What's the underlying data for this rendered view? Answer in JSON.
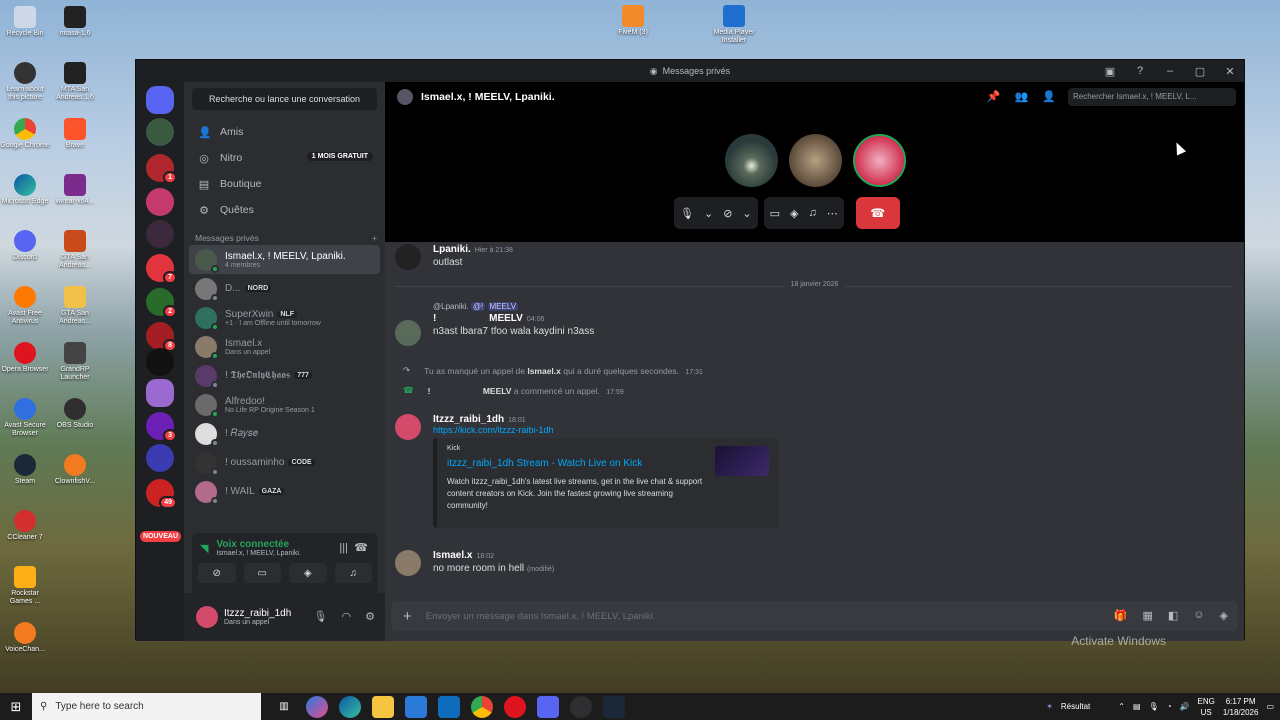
{
  "desktop": {
    "left_icons": [
      "Recycle Bin",
      "mtasa-1.6",
      "Learn about this picture",
      "MTA San Andreas 1.6",
      "Google Chrome",
      "Brave",
      "Microsoft Edge",
      "winrar-x64...",
      "Discord",
      "GTA San Andreas...",
      "Avast Free Antivirus",
      "GTA San Andreas...",
      "Opera Browser",
      "GrandRP Launcher",
      "Avast Secure Browser",
      "OBS Studio",
      "Steam",
      "ClownfishV...",
      "CCleaner 7",
      "Rockstar Games ...",
      "VoiceChan..."
    ],
    "top_icons": [
      "FiveM (3)",
      "Media Player Installer"
    ],
    "watermark": "Activate Windows"
  },
  "window": {
    "title": "Messages privés"
  },
  "server_badges": [
    "1",
    "7",
    "2",
    "8",
    "3",
    "49"
  ],
  "new_badge": "NOUVEAU",
  "sidebar": {
    "search": "Recherche ou lance une conversation",
    "nav": [
      {
        "label": "Amis",
        "icon": "friends-icon"
      },
      {
        "label": "Nitro",
        "icon": "nitro-icon",
        "badge": "1 MOIS GRATUIT"
      },
      {
        "label": "Boutique",
        "icon": "shop-icon"
      },
      {
        "label": "Quêtes",
        "icon": "quests-icon"
      }
    ],
    "dm_header": "Messages privés",
    "dms": [
      {
        "name": "Ismael.x, ! MEELV, Lpaniki.",
        "sub": "4 membres",
        "tag": ""
      },
      {
        "name": "D...",
        "sub": "",
        "tag": "NORD"
      },
      {
        "name": "SuperXwin",
        "sub": "+1 · I am Offline until tomorrow",
        "tag": "NLF"
      },
      {
        "name": "Ismael.x",
        "sub": "Dans un appel",
        "tag": ""
      },
      {
        "name": "! 𝕿𝖍𝖊𝕺𝖓𝖑𝖞𝕮𝖍𝖆𝖔𝖘",
        "sub": "",
        "tag": "777"
      },
      {
        "name": "Alfredoo!",
        "sub": "No Life RP Origine Season 1",
        "tag": ""
      },
      {
        "name": "! 𝑅𝑎𝑦𝑠𝑒",
        "sub": "",
        "tag": ""
      },
      {
        "name": "! oussaminho",
        "sub": "",
        "tag": "CODE"
      },
      {
        "name": "! WAIL",
        "sub": "",
        "tag": "GAZA"
      }
    ],
    "voice": {
      "title": "Voix connectée",
      "sub": "Ismael.x, ! MEELV, Lpaniki."
    },
    "user": {
      "name": "Itzzz_raibi_1dh",
      "status": "Dans un appel"
    }
  },
  "header": {
    "title": "Ismael.x, ! MEELV, Lpaniki.",
    "search_placeholder": "Rechercher Ismael.x, ! MEELV, L..."
  },
  "messages": {
    "m1": {
      "author": "Lpaniki.",
      "time": "Hier à 21:38",
      "text": "outlast"
    },
    "date_divider": "18 janvier 2026",
    "m2": {
      "reply_author": "@Lpaniki.",
      "reply_mention": "@!",
      "reply_mention2": "MEELV",
      "author_prefix": "!",
      "author": "MEELV",
      "time": "04:06",
      "text": "n3ast lbara7 tfoo wala kaydini n3ass"
    },
    "sys1": {
      "pre": "Tu as manqué un appel de",
      "name": "Ismael.x",
      "post": "qui a duré quelques secondes.",
      "time": "17:31"
    },
    "sys2": {
      "prefix": "!",
      "name": "MEELV",
      "post": "a commencé un appel.",
      "time": "17:59"
    },
    "m3": {
      "author": "Itzzz_raibi_1dh",
      "time": "18:01",
      "link": "https://kick.com/itzzz-raibi-1dh",
      "embed": {
        "provider": "Kick",
        "title": "itzzz_raibi_1dh Stream - Watch Live on Kick",
        "desc": "Watch itzzz_raibi_1dh's latest live streams, get in the live chat & support content creators on Kick. Join the fastest growing live streaming community!"
      }
    },
    "m4": {
      "author": "Ismael.x",
      "time": "18:02",
      "text": "no more room in hell",
      "edited": "(modifié)"
    }
  },
  "composer": {
    "placeholder": "Envoyer un message dans Ismael.x, ! MEELV, Lpaniki."
  },
  "taskbar": {
    "search": "Type here to search",
    "weather": "Résultat",
    "lang1": "ENG",
    "lang2": "US",
    "time": "6:17 PM",
    "date": "1/18/2026"
  }
}
